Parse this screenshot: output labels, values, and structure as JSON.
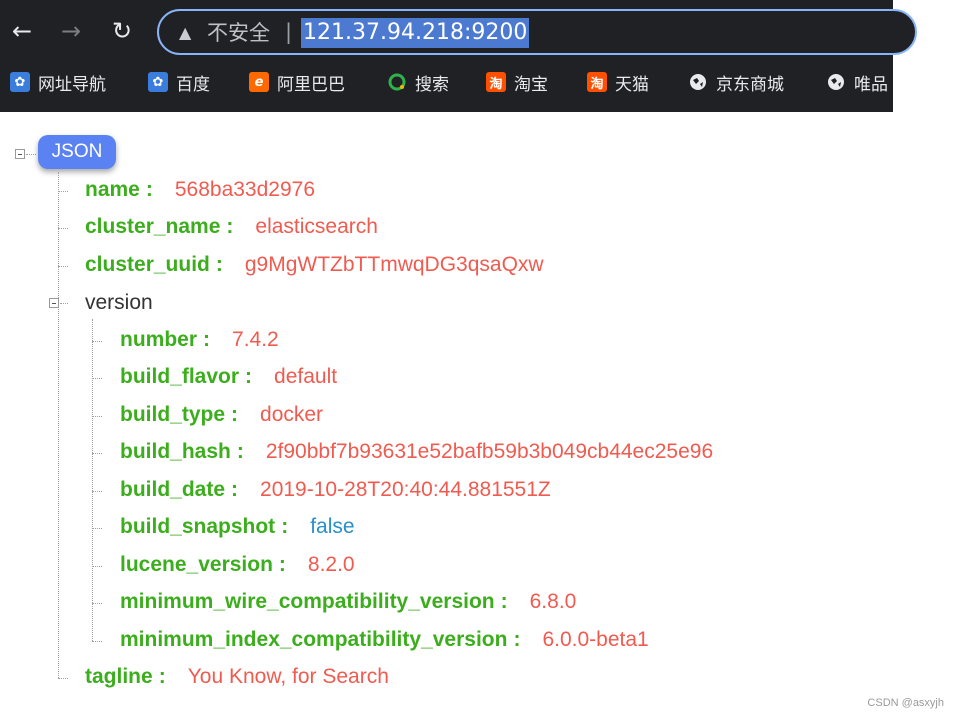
{
  "browser": {
    "security_label": "不安全",
    "separator": "|",
    "url": "121.37.94.218:9200"
  },
  "bookmarks": [
    {
      "label": "网址导航",
      "icon": "baidu-paw-icon"
    },
    {
      "label": "百度",
      "icon": "baidu-paw-icon"
    },
    {
      "label": "阿里巴巴",
      "icon": "alibaba-icon"
    },
    {
      "label": "搜索",
      "icon": "search-360-icon"
    },
    {
      "label": "淘宝",
      "icon": "taobao-icon"
    },
    {
      "label": "天猫",
      "icon": "taobao-icon"
    },
    {
      "label": "京东商城",
      "icon": "globe-icon"
    },
    {
      "label": "唯品",
      "icon": "globe-icon"
    }
  ],
  "json_tree": {
    "root_label": "JSON",
    "name": {
      "key": "name",
      "value": "568ba33d2976"
    },
    "cluster_name": {
      "key": "cluster_name",
      "value": "elasticsearch"
    },
    "cluster_uuid": {
      "key": "cluster_uuid",
      "value": "g9MgWTZbTTmwqDG3qsaQxw"
    },
    "version_label": "version",
    "version": {
      "number": {
        "key": "number",
        "value": "7.4.2"
      },
      "build_flavor": {
        "key": "build_flavor",
        "value": "default"
      },
      "build_type": {
        "key": "build_type",
        "value": "docker"
      },
      "build_hash": {
        "key": "build_hash",
        "value": "2f90bbf7b93631e52bafb59b3b049cb44ec25e96"
      },
      "build_date": {
        "key": "build_date",
        "value": "2019-10-28T20:40:44.881551Z"
      },
      "build_snapshot": {
        "key": "build_snapshot",
        "value": "false"
      },
      "lucene_version": {
        "key": "lucene_version",
        "value": "8.2.0"
      },
      "minimum_wire_compatibility_version": {
        "key": "minimum_wire_compatibility_version",
        "value": "6.8.0"
      },
      "minimum_index_compatibility_version": {
        "key": "minimum_index_compatibility_version",
        "value": "6.0.0-beta1"
      }
    },
    "tagline": {
      "key": "tagline",
      "value": "You Know, for Search"
    },
    "colon": ":"
  },
  "watermark": "CSDN @asxyjh",
  "colors": {
    "key": "#3cae1d",
    "string_value": "#f05b50",
    "boolean_value": "#2891c9",
    "root_badge": "#5b82f3",
    "url_highlight": "#4c7ad0"
  }
}
